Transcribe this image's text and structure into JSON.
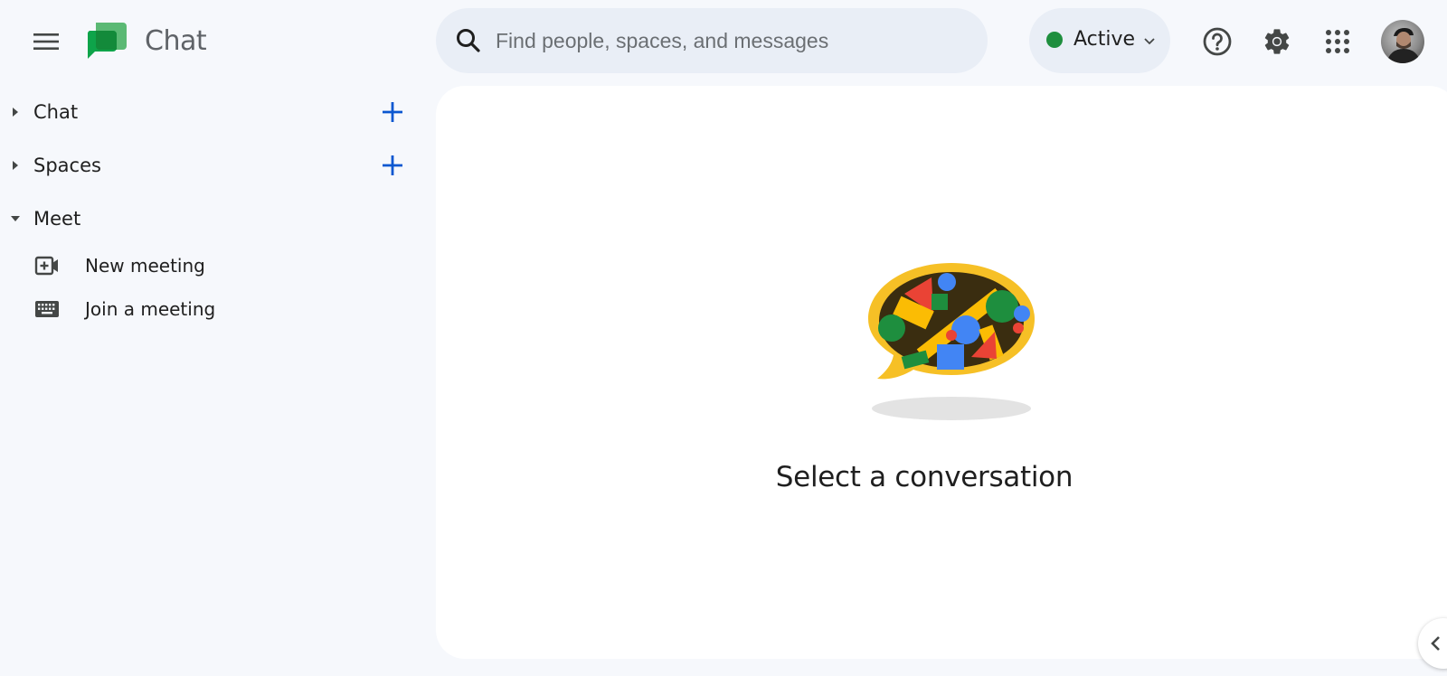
{
  "header": {
    "app_title": "Chat",
    "menu_icon": "hamburger-menu-icon",
    "logo_icon": "google-chat-logo-icon",
    "search": {
      "placeholder": "Find people, spaces, and messages",
      "value": "",
      "icon": "search-icon"
    },
    "status": {
      "label": "Active",
      "color": "#1e8e3e",
      "icon": "chevron-down-icon"
    },
    "actions": [
      {
        "name": "help",
        "icon": "help-circle-icon"
      },
      {
        "name": "settings",
        "icon": "gear-icon"
      },
      {
        "name": "google-apps",
        "icon": "apps-grid-icon"
      },
      {
        "name": "account",
        "icon": "avatar"
      }
    ]
  },
  "sidebar": {
    "sections": [
      {
        "label": "Chat",
        "expanded": false,
        "has_add": true
      },
      {
        "label": "Spaces",
        "expanded": false,
        "has_add": true
      },
      {
        "label": "Meet",
        "expanded": true,
        "has_add": false
      }
    ],
    "meet_items": [
      {
        "label": "New meeting",
        "icon": "video-plus-icon"
      },
      {
        "label": "Join a meeting",
        "icon": "keyboard-icon"
      }
    ],
    "accent_color": "#0b57d0"
  },
  "main": {
    "empty_state_title": "Select a conversation",
    "illustration": "chat-bubble-shapes-illustration"
  },
  "side_panel_toggle": {
    "icon": "chevron-left-icon"
  }
}
